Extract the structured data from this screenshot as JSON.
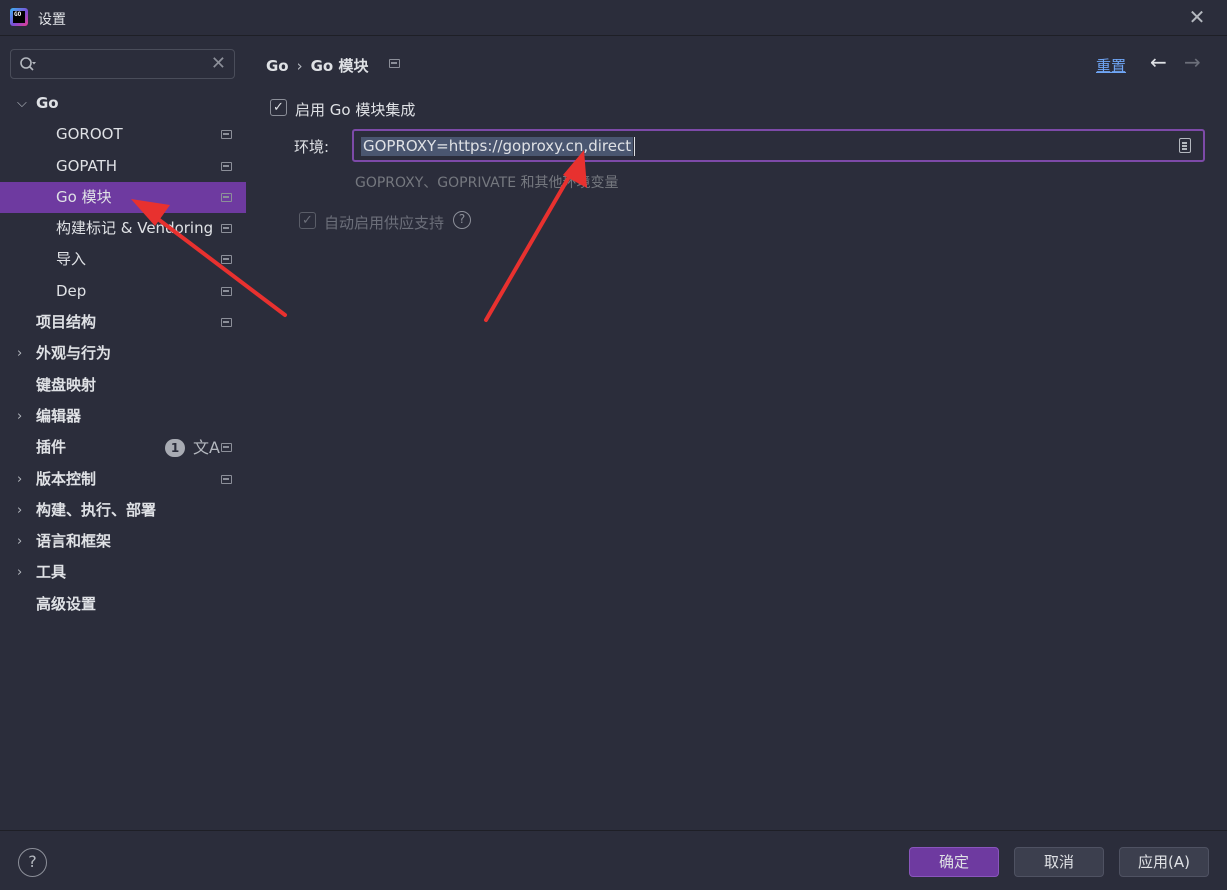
{
  "window": {
    "title": "设置"
  },
  "search": {
    "placeholder": ""
  },
  "sidebar": {
    "items": [
      {
        "label": "Go",
        "level": 0,
        "expanded": true,
        "bold": true
      },
      {
        "label": "GOROOT",
        "level": 1
      },
      {
        "label": "GOPATH",
        "level": 1
      },
      {
        "label": "Go 模块",
        "level": 1,
        "selected": true
      },
      {
        "label": "构建标记 & Vendoring",
        "level": 1
      },
      {
        "label": "导入",
        "level": 1
      },
      {
        "label": "Dep",
        "level": 1
      },
      {
        "label": "项目结构",
        "level": 0,
        "bold": true
      },
      {
        "label": "外观与行为",
        "level": 0,
        "bold": true
      },
      {
        "label": "键盘映射",
        "level": 0,
        "bold": true
      },
      {
        "label": "编辑器",
        "level": 0,
        "bold": true
      },
      {
        "label": "插件",
        "level": 0,
        "bold": true,
        "badge": "1"
      },
      {
        "label": "版本控制",
        "level": 0,
        "bold": true
      },
      {
        "label": "构建、执行、部署",
        "level": 0,
        "bold": true
      },
      {
        "label": "语言和框架",
        "level": 0,
        "bold": true
      },
      {
        "label": "工具",
        "level": 0,
        "bold": true
      },
      {
        "label": "高级设置",
        "level": 0,
        "bold": true
      }
    ]
  },
  "main": {
    "breadcrumb": {
      "parent": "Go",
      "current": "Go 模块"
    },
    "reset_label": "重置",
    "enable_modules": {
      "label": "启用 Go 模块集成",
      "checked": true
    },
    "environment": {
      "label": "环境:",
      "value": "GOPROXY=https://goproxy.cn,direct",
      "hint": "GOPROXY、GOPRIVATE 和其他环境变量"
    },
    "vendoring": {
      "label": "自动启用供应支持",
      "checked": true,
      "disabled": true
    }
  },
  "footer": {
    "ok_label": "确定",
    "cancel_label": "取消",
    "apply_label": "应用(A)"
  },
  "colors": {
    "background": "#2b2d3b",
    "selection": "#6e3aa0",
    "link": "#6fa5f5",
    "annotation_arrow": "#e8312f"
  }
}
